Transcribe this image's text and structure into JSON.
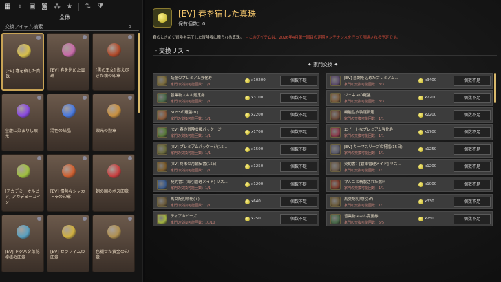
{
  "toolbar": {
    "icons": [
      "map-pin-icon",
      "location-icon",
      "bag-icon",
      "camera-icon",
      "network-icon",
      "star-icon",
      "sort-icon",
      "filter-icon"
    ],
    "all_label": "全体"
  },
  "search": {
    "placeholder": "交換アイテム検索"
  },
  "left_cards": [
    {
      "label": "[EV] 春を宿した真珠",
      "color": "#d8c04a",
      "selected": true
    },
    {
      "label": "[EV] 春を込めた真珠",
      "color": "#c86aa8",
      "selected": false
    },
    {
      "label": "[黒の王女] 燃え尽きた魂の印章",
      "color": "#b04a2a",
      "selected": false
    },
    {
      "label": "空虚に染まりし眼光",
      "color": "#8a4ae0",
      "selected": false
    },
    {
      "label": "混色の結晶",
      "color": "#4a7ae0",
      "selected": false
    },
    {
      "label": "栄光の勲章",
      "color": "#c89040",
      "selected": false
    },
    {
      "label": "[アカデミーオルビア] アカデミーコイン",
      "color": "#a0c040",
      "selected": false
    },
    {
      "label": "[EV] 情熱なシャカトゥの印章",
      "color": "#d06030",
      "selected": false
    },
    {
      "label": "朝の国のボス印章",
      "color": "#c84040",
      "selected": false
    },
    {
      "label": "[EV] ドタバタ菜花模様の印章",
      "color": "#5aa0c0",
      "selected": false
    },
    {
      "label": "[EV] セラフィムの印章",
      "color": "#d0b040",
      "selected": false
    },
    {
      "label": "色褪せた黄金の印章",
      "color": "#b09050",
      "selected": false
    }
  ],
  "detail": {
    "title": "[EV] 春を宿した真珠",
    "owned": "保有個数：0",
    "description": "春のときめく冒険を完了した冒険者に贈られる真珠。",
    "warning": "- このアイテムは、2026年4月第一回目の定期メンテナンスを行って削除される予定です。",
    "list_title": "・交換リスト",
    "section_label": "✦ 家門交換 ✦"
  },
  "rows": [
    {
      "name": "話題のプレミアム強化券",
      "limit": "家門の交換可能回数：1/1",
      "cost": "x10200",
      "button": "個数不足",
      "color": "#7a6a3a"
    },
    {
      "name": "[EV] 感謝を込めたプレミアム...",
      "limit": "家門の交換可能回数：3/3",
      "cost": "x3400",
      "button": "個数不足",
      "color": "#5a4a6a"
    },
    {
      "name": "皆業物スキル鑑定券",
      "limit": "家門の交換可能回数：1/1",
      "cost": "x3100",
      "button": "個数不足",
      "color": "#4a6a4a"
    },
    {
      "name": "ジェネスの羅盤",
      "limit": "家門の交換可能回数：3/3",
      "cost": "x2200",
      "button": "個数不足",
      "color": "#7a5a3a"
    },
    {
      "name": "5D55の羅盤(N)",
      "limit": "家門の交換可能回数：1/1",
      "cost": "x2200",
      "button": "個数不足",
      "color": "#8a5a3a"
    },
    {
      "name": "機能性衣装選択箱",
      "limit": "家門の交換可能回数：1/1",
      "cost": "x2200",
      "button": "個数不足",
      "color": "#6a4a3a"
    },
    {
      "name": "[EV] 春の冒険支援パッケージ",
      "limit": "家門の交換可能回数：1/1",
      "cost": "x1700",
      "button": "個数不足",
      "color": "#5a7a3a"
    },
    {
      "name": "エイートなプレミアム強化券",
      "limit": "家門の交換可能回数：1/1",
      "cost": "x1700",
      "button": "個数不足",
      "color": "#8a3a4a"
    },
    {
      "name": "[EV] プレミアムパッケージ(15...",
      "limit": "家門の交換可能回数：1/1",
      "cost": "x1500",
      "button": "個数不足",
      "color": "#6a6a3a"
    },
    {
      "name": "[EV] カーマスリープの祝福(15日)",
      "limit": "家門の交換可能回数：1/1",
      "cost": "x1250",
      "button": "個数不足",
      "color": "#5a5a6a"
    },
    {
      "name": "[EV] 終末の月輪伝書(15日)",
      "limit": "家門の交換可能回数：1/1",
      "cost": "x1250",
      "button": "個数不足",
      "color": "#7a5a2a"
    },
    {
      "name": "契約書：[倉庫管理メイド] リス...",
      "limit": "家門の交換可能回数：1/1",
      "cost": "x1200",
      "button": "個数不足",
      "color": "#6a5a4a"
    },
    {
      "name": "契約書：[取引管理メイド] リス...",
      "limit": "家門の交換可能回数：1/1",
      "cost": "x1200",
      "button": "個数不足",
      "color": "#3a5a8a"
    },
    {
      "name": "マルニの精製された燃料",
      "limit": "家門の交換可能回数：1/1",
      "cost": "x1000",
      "button": "個数不足",
      "color": "#7a3a2a"
    },
    {
      "name": "馬交配初期化(+)",
      "limit": "家門の交換可能回数：1/1",
      "cost": "x640",
      "button": "個数不足",
      "color": "#6a5a3a"
    },
    {
      "name": "馬交配初期化(♂)",
      "limit": "家門の交換可能回数：1/1",
      "cost": "x330",
      "button": "個数不足",
      "color": "#6a5a3a"
    },
    {
      "name": "ティアのビーズ",
      "limit": "家門の交換可能回数：10/10",
      "cost": "x250",
      "button": "個数不足",
      "color": "#a0b040"
    },
    {
      "name": "皆業物スキル変更券",
      "limit": "家門の交換可能回数：5/5",
      "cost": "x250",
      "button": "個数不足",
      "color": "#4a6a4a"
    }
  ]
}
